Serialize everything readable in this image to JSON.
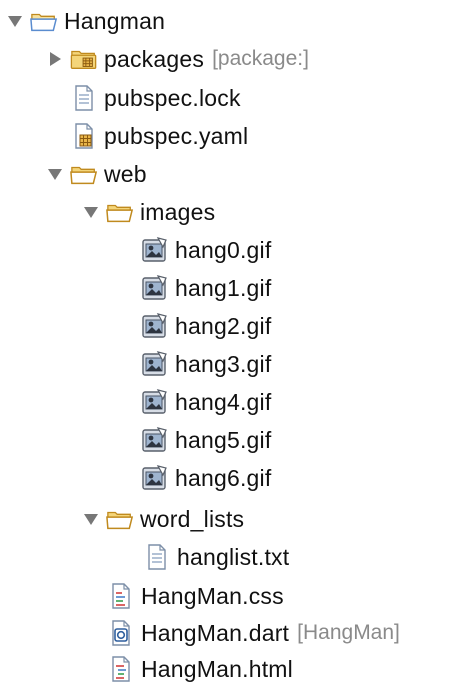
{
  "tree": {
    "root": {
      "label": "Hangman",
      "icon": "project-folder-icon",
      "expanded": true
    },
    "packages": {
      "label": "packages",
      "decoration": "[package:]",
      "icon": "package-folder-icon",
      "expanded": false
    },
    "pubspec_lock": {
      "label": "pubspec.lock",
      "icon": "text-file-icon"
    },
    "pubspec_yaml": {
      "label": "pubspec.yaml",
      "icon": "yaml-file-icon"
    },
    "web": {
      "label": "web",
      "icon": "folder-icon",
      "expanded": true
    },
    "images": {
      "label": "images",
      "icon": "folder-icon",
      "expanded": true
    },
    "image_files": [
      {
        "label": "hang0.gif",
        "icon": "image-file-icon"
      },
      {
        "label": "hang1.gif",
        "icon": "image-file-icon"
      },
      {
        "label": "hang2.gif",
        "icon": "image-file-icon"
      },
      {
        "label": "hang3.gif",
        "icon": "image-file-icon"
      },
      {
        "label": "hang4.gif",
        "icon": "image-file-icon"
      },
      {
        "label": "hang5.gif",
        "icon": "image-file-icon"
      },
      {
        "label": "hang6.gif",
        "icon": "image-file-icon"
      }
    ],
    "word_lists": {
      "label": "word_lists",
      "icon": "folder-icon",
      "expanded": true
    },
    "hanglist": {
      "label": "hanglist.txt",
      "icon": "text-file-icon"
    },
    "css_file": {
      "label": "HangMan.css",
      "icon": "css-file-icon"
    },
    "dart_file": {
      "label": "HangMan.dart",
      "decoration": "[HangMan]",
      "icon": "dart-file-icon"
    },
    "html_file": {
      "label": "HangMan.html",
      "icon": "html-file-icon"
    }
  },
  "colors": {
    "folder_fill": "#f4d57a",
    "folder_stroke": "#c08a1e",
    "open_folder_fill": "#ffffff",
    "root_folder_accent": "#6fa0d8",
    "twisty": "#777777",
    "decoration_text": "#8a8a8a"
  }
}
